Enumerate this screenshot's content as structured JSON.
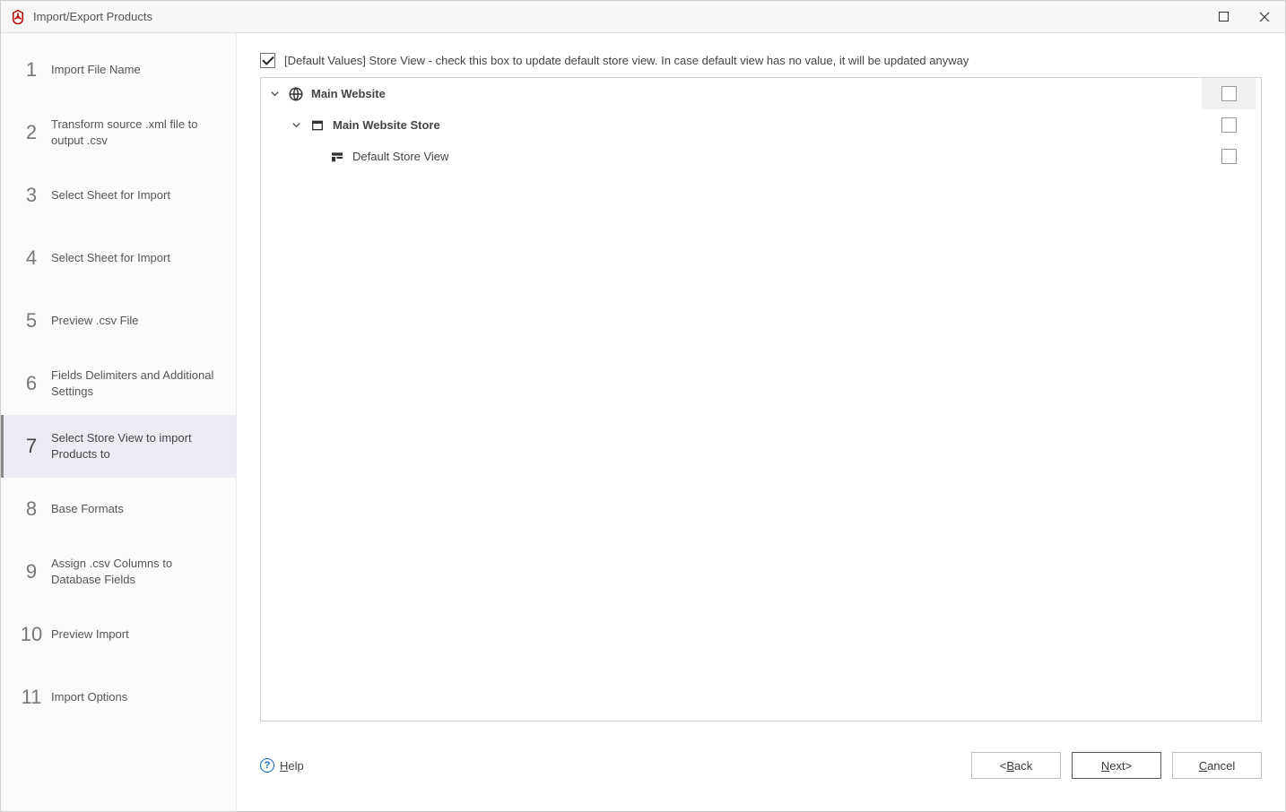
{
  "window": {
    "title": "Import/Export Products"
  },
  "sidebar": {
    "steps": [
      {
        "num": "1",
        "label": "Import File Name"
      },
      {
        "num": "2",
        "label": "Transform source .xml file to output .csv"
      },
      {
        "num": "3",
        "label": "Select Sheet for Import"
      },
      {
        "num": "4",
        "label": "Select Sheet for Import"
      },
      {
        "num": "5",
        "label": "Preview .csv File"
      },
      {
        "num": "6",
        "label": "Fields Delimiters and Additional Settings"
      },
      {
        "num": "7",
        "label": "Select Store View to import Products to"
      },
      {
        "num": "8",
        "label": "Base Formats"
      },
      {
        "num": "9",
        "label": "Assign .csv Columns to Database Fields"
      },
      {
        "num": "10",
        "label": "Preview Import"
      },
      {
        "num": "11",
        "label": "Import Options"
      }
    ],
    "active_index": 6
  },
  "defaults": {
    "checked": true,
    "text": "[Default Values] Store View - check this box to update default store view. In case default view has no value, it will be updated anyway"
  },
  "tree": {
    "root": {
      "label": "Main Website",
      "children": [
        {
          "label": "Main Website Store",
          "children": [
            {
              "label": "Default Store View"
            }
          ]
        }
      ]
    }
  },
  "footer": {
    "help": "Help",
    "back": "Back",
    "back_prefix": "< ",
    "next": "Next",
    "next_suffix": " >",
    "cancel": "Cancel"
  }
}
